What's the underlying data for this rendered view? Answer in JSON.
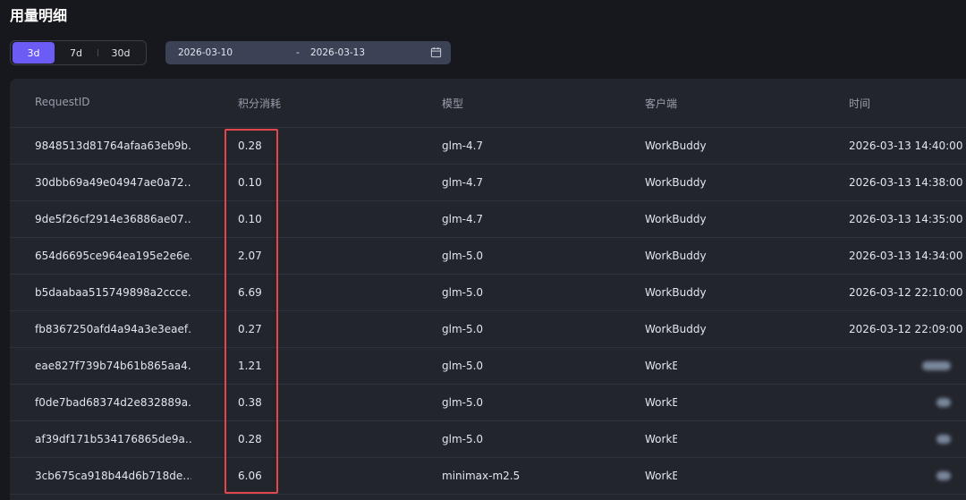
{
  "page": {
    "title": "用量明细"
  },
  "range": {
    "options": [
      "3d",
      "7d",
      "30d"
    ],
    "selected": "3d"
  },
  "date_range": {
    "start": "2026-03-10",
    "separator": "-",
    "end": "2026-03-13",
    "icon": "calendar-icon"
  },
  "table": {
    "headers": [
      "RequestID",
      "积分消耗",
      "模型",
      "客户端",
      "时间"
    ],
    "rows": [
      {
        "id": "9848513d81764afaa63eb9b…",
        "points": "0.28",
        "model": "glm-4.7",
        "client": "WorkBuddy",
        "time": "2026-03-13 14:40:00"
      },
      {
        "id": "30dbb69a49e04947ae0a72…",
        "points": "0.10",
        "model": "glm-4.7",
        "client": "WorkBuddy",
        "time": "2026-03-13 14:38:00"
      },
      {
        "id": "9de5f26cf2914e36886ae07…",
        "points": "0.10",
        "model": "glm-4.7",
        "client": "WorkBuddy",
        "time": "2026-03-13 14:35:00"
      },
      {
        "id": "654d6695ce964ea195e2e6e…",
        "points": "2.07",
        "model": "glm-5.0",
        "client": "WorkBuddy",
        "time": "2026-03-13 14:34:00"
      },
      {
        "id": "b5daabaa515749898a2ccce…",
        "points": "6.69",
        "model": "glm-5.0",
        "client": "WorkBuddy",
        "time": "2026-03-12 22:10:00"
      },
      {
        "id": "fb8367250afd4a94a3e3eaef…",
        "points": "0.27",
        "model": "glm-5.0",
        "client": "WorkBuddy",
        "time": "2026-03-12 22:09:00"
      },
      {
        "id": "eae827f739b74b61b865aa4…",
        "points": "1.21",
        "model": "glm-5.0",
        "client": "WorkE",
        "time": ""
      },
      {
        "id": "f0de7bad68374d2e832889a…",
        "points": "0.38",
        "model": "glm-5.0",
        "client": "WorkE",
        "time": ""
      },
      {
        "id": "af39df171b534176865de9a…",
        "points": "0.28",
        "model": "glm-5.0",
        "client": "WorkE",
        "time": ""
      },
      {
        "id": "3cb675ca918b44d6b718de…",
        "points": "6.06",
        "model": "minimax-m2.5",
        "client": "WorkE",
        "time": ""
      }
    ]
  },
  "colors": {
    "accent": "#6c5cf6",
    "highlight": "#e2474b",
    "background": "#17181d",
    "panel": "#23252d"
  }
}
